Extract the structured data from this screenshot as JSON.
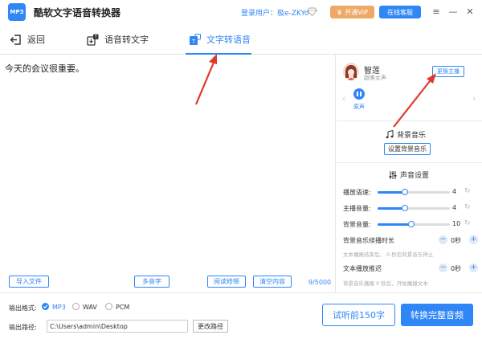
{
  "app": {
    "logo_text": "MP3",
    "title": "酷软文字语音转换器",
    "login_label": "登录用户：",
    "user_name": "极e-ZKYo",
    "vip_label": "开通VIP",
    "service_label": "在线客服"
  },
  "tabs": [
    {
      "label": "返回",
      "icon": "back-icon"
    },
    {
      "label": "语音转文字",
      "icon": "speech-to-text-icon"
    },
    {
      "label": "文字转语音",
      "icon": "text-to-speech-icon",
      "active": true
    }
  ],
  "editor": {
    "text": "今天的会议很重要。",
    "import_label": "导入文件",
    "polyphone_label": "多音字",
    "proofread_label": "阅读修顿",
    "clear_label": "清空内容",
    "char_count": "9/5000"
  },
  "voice": {
    "name": "智莲",
    "desc": "甜美女声",
    "change_label": "更换主播",
    "original_label": "原声"
  },
  "bgm": {
    "title": "背景音乐",
    "set_label": "设置背景音乐"
  },
  "sound": {
    "title": "声音设置",
    "sliders": [
      {
        "label": "播放语速:",
        "value": "4",
        "fraction": 0.38
      },
      {
        "label": "主播音量:",
        "value": "4",
        "fraction": 0.38
      },
      {
        "label": "背景音量:",
        "value": "10",
        "fraction": 0.47
      }
    ],
    "bgm_delay": {
      "label": "背景音乐续播时长",
      "value": "0秒",
      "hint": "文本播报结束后，  0 秒后背景音乐停止"
    },
    "text_delay": {
      "label": "文本播放推迟",
      "value": "0秒",
      "hint": "背景音乐播报   0 秒后，开始播报文本"
    }
  },
  "output": {
    "format_label": "输出格式:",
    "formats": [
      "MP3",
      "WAV",
      "PCM"
    ],
    "selected": "MP3",
    "path_label": "输出路径:",
    "path_value": "C:\\Users\\admin\\Desktop",
    "change_path_label": "更改路径",
    "preview_label": "试听前150字",
    "convert_label": "转换完整音频"
  },
  "colors": {
    "accent": "#2f86f6",
    "vip": "#f0a868",
    "annotation": "#e03a2f"
  }
}
